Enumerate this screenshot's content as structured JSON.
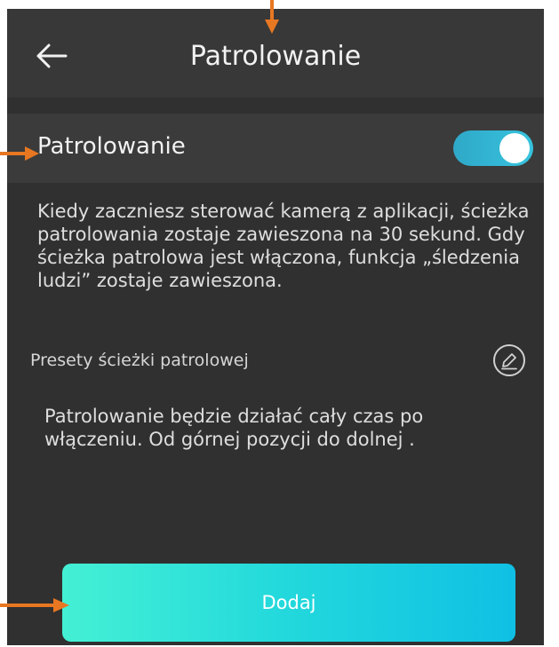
{
  "header": {
    "title": "Patrolowanie"
  },
  "patrol_row": {
    "label": "Patrolowanie",
    "toggle_on": true
  },
  "description": "Kiedy zaczniesz sterować kamerą z aplikacji, ścieżka patrolowania zostaje zawieszona na 30 sekund. Gdy ścieżka patrolowa jest włączona, funkcja „śledzenia ludzi” zostaje zawieszona.",
  "presets": {
    "label": "Presety ścieżki patrolowej"
  },
  "info": "Patrolowanie będzie działać cały czas po włączeniu. Od górnej pozycji do dolnej .",
  "add_button": {
    "label": "Dodaj"
  },
  "colors": {
    "background": "#303030",
    "toggle": "#36c4de",
    "button_start": "#44f0d4",
    "button_end": "#10c0e4",
    "annotation_arrow": "#e87722"
  },
  "icons": [
    "back-arrow-icon",
    "edit-icon",
    "annotation-arrow-icon"
  ]
}
